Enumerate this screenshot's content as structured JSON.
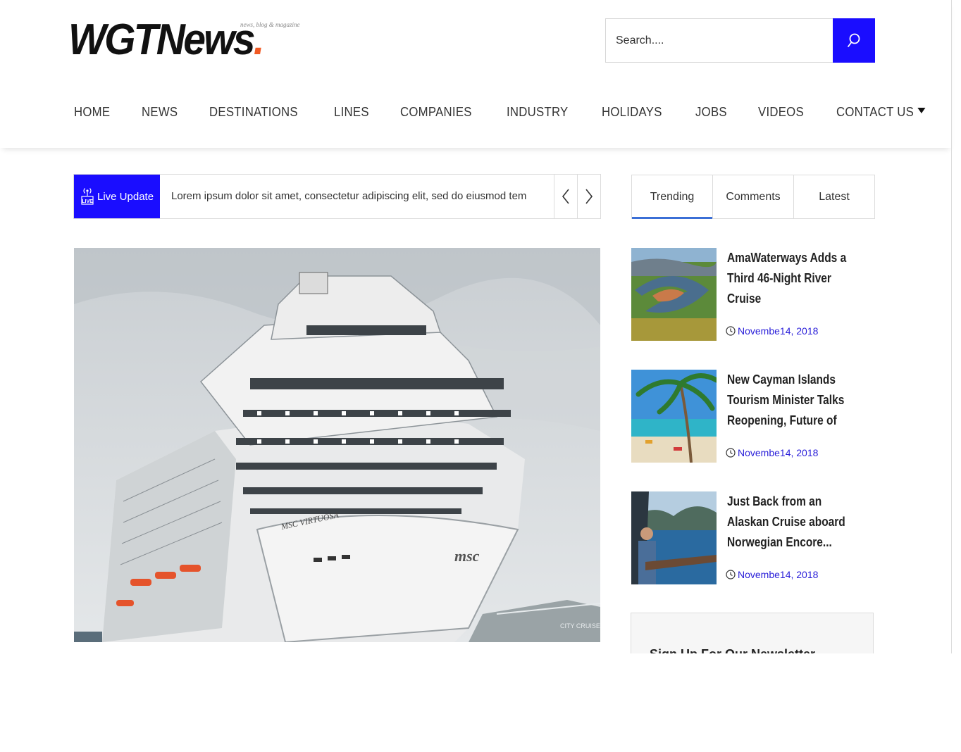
{
  "brand": {
    "logo_text": "WGTNews",
    "logo_dot": ".",
    "tagline": "news, blog & magazine",
    "accent_color": "#1a0dff",
    "logo_dot_color": "#f15a24"
  },
  "search": {
    "placeholder": "Search....",
    "icon": "search-icon"
  },
  "nav": {
    "items": [
      {
        "label": "HOME"
      },
      {
        "label": "NEWS"
      },
      {
        "label": "DESTINATIONS"
      },
      {
        "label": "LINES"
      },
      {
        "label": "COMPANIES"
      },
      {
        "label": "INDUSTRY"
      },
      {
        "label": "HOLIDAYS"
      },
      {
        "label": "JOBS"
      },
      {
        "label": "VIDEOS"
      },
      {
        "label": "CONTACT US",
        "has_dropdown": true
      }
    ]
  },
  "ticker": {
    "badge_label": "Live Update",
    "badge_icon": "live-broadcast-icon",
    "text": "Lorem ipsum dolor sit amet, consectetur adipiscing elit, sed do eiusmod tem",
    "prev_icon": "chevron-left-icon",
    "next_icon": "chevron-right-icon"
  },
  "hero": {
    "image": "cruise-ship-photo",
    "ship_name": "MSC VIRTUOSA"
  },
  "tabs": {
    "items": [
      {
        "label": "Trending",
        "active": true
      },
      {
        "label": "Comments",
        "active": false
      },
      {
        "label": "Latest",
        "active": false
      }
    ]
  },
  "articles": [
    {
      "title": "AmaWaterways Adds a Third 46-Night River Cruise",
      "date": "Novembe14, 2018",
      "thumb": "river-valley-photo"
    },
    {
      "title": "New Cayman Islands Tourism Minister Talks Reopening, Future of",
      "date": "Novembe14, 2018",
      "thumb": "tropical-beach-photo"
    },
    {
      "title": "Just Back from an Alaskan Cruise aboard Norwegian Encore...",
      "date": "Novembe14, 2018",
      "thumb": "alaska-cruise-deck-photo"
    }
  ],
  "newsletter": {
    "title": "Sign Up For Our Newsletter"
  }
}
